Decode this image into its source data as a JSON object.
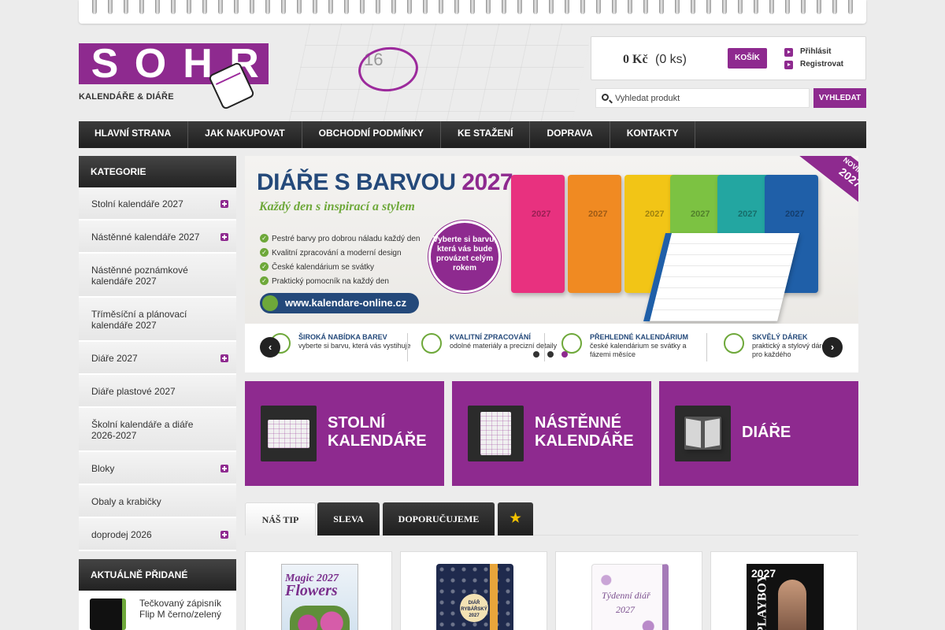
{
  "brand": {
    "logo_letters": [
      "S",
      "O",
      "H",
      "R"
    ],
    "tagline": "KALENDÁŘE & DIÁŘE",
    "header_decoration_number": "16"
  },
  "cart": {
    "total": "0 Kč",
    "count": "(0 ks)",
    "button_label": "KOŠÍK"
  },
  "account": {
    "login_label": "Přihlásit",
    "register_label": "Registrovat"
  },
  "search": {
    "placeholder": "Vyhledat produkt",
    "value": "",
    "button_label": "VYHLEDAT"
  },
  "nav": {
    "items": [
      "HLAVNÍ STRANA",
      "JAK NAKUPOVAT",
      "OBCHODNÍ PODMÍNKY",
      "KE STAŽENÍ",
      "DOPRAVA",
      "KONTAKTY"
    ]
  },
  "sidebar": {
    "categories_title": "KATEGORIE",
    "categories": [
      {
        "label": "Stolní kalendáře 2027",
        "expandable": true
      },
      {
        "label": "Nástěnné kalendáře 2027",
        "expandable": true
      },
      {
        "label": "Nástěnné poznámkové kalendáře 2027",
        "expandable": false
      },
      {
        "label": "Tříměsíční a plánovací kalendáře 2027",
        "expandable": false
      },
      {
        "label": "Diáře 2027",
        "expandable": true
      },
      {
        "label": "Diáře plastové 2027",
        "expandable": false
      },
      {
        "label": "Školní kalendáře a diáře 2026-2027",
        "expandable": false
      },
      {
        "label": "Bloky",
        "expandable": true
      },
      {
        "label": "Obaly a krabičky",
        "expandable": false
      },
      {
        "label": "doprodej 2026",
        "expandable": true
      }
    ],
    "recent_title": "AKTUÁLNĚ PŘIDANÉ",
    "recent_item": "Tečkovaný zápisník Flip M černo/zelený"
  },
  "banner": {
    "title_main": "DIÁŘE S BARVOU",
    "title_year": "2027",
    "subtitle": "Každý den s inspirací a stylem",
    "features": [
      "Pestré barvy pro dobrou náladu každý den",
      "Kvalitní zpracování a moderní design",
      "České kalendárium se svátky",
      "Praktický pomocník na každý den"
    ],
    "url": "www.kalendare-online.cz",
    "badge_text": "Vyberte si barvu, která vás bude provázet celým rokem",
    "book_year": "2027",
    "ribbon_top": "NOVINKA",
    "ribbon_year": "2027",
    "strip": [
      {
        "title": "ŠIROKÁ NABÍDKA BAREV",
        "text": "vyberte si barvu, která vás vystihuje"
      },
      {
        "title": "KVALITNÍ ZPRACOVÁNÍ",
        "text": "odolné materiály a precizní detaily"
      },
      {
        "title": "PŘEHLEDNÉ KALENDÁRIUM",
        "text": "české kalendárium se svátky a fázemi měsíce"
      },
      {
        "title": "SKVĚLÝ DÁREK",
        "text": "praktický a stylový dárek pro každého"
      }
    ],
    "prev_label": "‹",
    "next_label": "›",
    "slides_total": 3,
    "active_slide": 3,
    "colors": {
      "navy": "#24497a",
      "green": "#6ea83a",
      "purple": "#8e2a8f"
    }
  },
  "tiles": [
    {
      "line1": "STOLNÍ",
      "line2": "KALENDÁŘE",
      "icon": "desk-calendar-icon"
    },
    {
      "line1": "NÁSTĚNNÉ",
      "line2": "KALENDÁŘE",
      "icon": "wall-calendar-icon"
    },
    {
      "line1": "DIÁŘE",
      "line2": "",
      "icon": "diary-icon"
    }
  ],
  "tabs": {
    "items": [
      "NÁŠ TIP",
      "SLEVA",
      "DOPORUČUJEME",
      "★"
    ],
    "active_index": 0
  },
  "products": [
    {
      "cover_line1": "Magic 2027",
      "cover_line2": "Flowers",
      "icon": "wall-calendar-flowers"
    },
    {
      "cover_label": "DIÁŘ RYBÁŘSKÝ 2027",
      "icon": "navy-diary"
    },
    {
      "cover_line1": "Týdenní diář",
      "cover_line2": "2027",
      "icon": "floral-diary"
    },
    {
      "cover_year": "2027",
      "cover_brand": "PLAYBOY",
      "icon": "playboy-calendar"
    }
  ],
  "theme": {
    "accent": "#8e2a8f",
    "dark": "#222222"
  }
}
